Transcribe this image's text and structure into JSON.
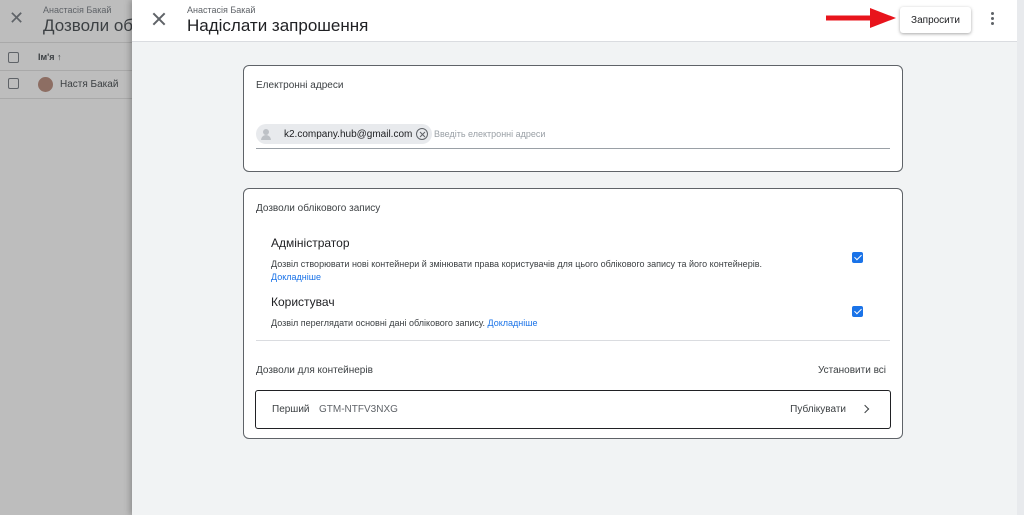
{
  "background": {
    "subtitle": "Анастасія Бакай",
    "title": "Дозволи облікового запису",
    "column_name": "Ім'я ↑",
    "rows": [
      {
        "name": "Настя Бакай"
      }
    ]
  },
  "panel": {
    "breadcrumb": "Анастасія Бакай",
    "title": "Надіслати запрошення",
    "invite_label": "Запросити",
    "icons": {
      "close": "close-icon",
      "more": "more-vert-icon",
      "annotation": "red-arrow"
    }
  },
  "emails": {
    "label": "Електронні адреси",
    "chips": [
      "k2.company.hub@gmail.com"
    ],
    "placeholder": "Введіть електронні адреси"
  },
  "account_permissions": {
    "label": "Дозволи облікового запису",
    "roles": [
      {
        "title": "Адміністратор",
        "description": "Дозвіл створювати нові контейнери й змінювати права користувачів для цього облікового запису та його контейнерів.",
        "link": "Докладніше",
        "checked": true
      },
      {
        "title": "Користувач",
        "description": "Дозвіл переглядати основні дані облікового запису.",
        "link": "Докладніше",
        "checked": true
      }
    ]
  },
  "container_permissions": {
    "label": "Дозволи для контейнерів",
    "set_all": "Установити всі",
    "containers": [
      {
        "name": "Перший",
        "id": "GTM-NTFV3NXG",
        "permission": "Публікувати"
      }
    ]
  },
  "colors": {
    "accent": "#1a73e8",
    "arrow": "#e8141c"
  }
}
